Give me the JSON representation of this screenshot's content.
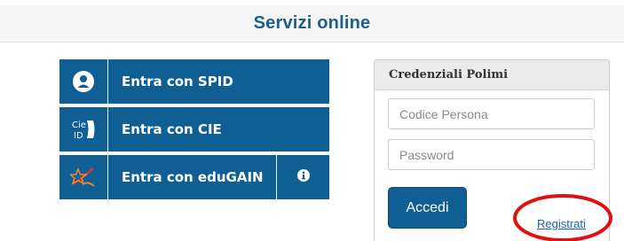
{
  "header": {
    "title": "Servizi online"
  },
  "login_options": [
    {
      "label": "Entra con SPID",
      "icon": "spid-user-icon"
    },
    {
      "label": "Entra con CIE",
      "icon": "cie-id-icon"
    },
    {
      "label": "Entra con eduGAIN",
      "icon": "edugain-icon"
    }
  ],
  "edugain_info": {
    "icon": "info-icon"
  },
  "credentials": {
    "title": "Credenziali Polimi",
    "codice_persona": {
      "value": "",
      "placeholder": "Codice Persona"
    },
    "password": {
      "value": "",
      "placeholder": "Password"
    },
    "submit_label": "Accedi",
    "register_label": "Registrati",
    "cie_icon_text": "Cie\nID"
  },
  "colors": {
    "brand_blue": "#0f5f95",
    "title_blue": "#1c5f8f",
    "highlight_red": "#e01010",
    "edugain_star": "#e9882b",
    "edugain_accent": "#d9303a"
  }
}
